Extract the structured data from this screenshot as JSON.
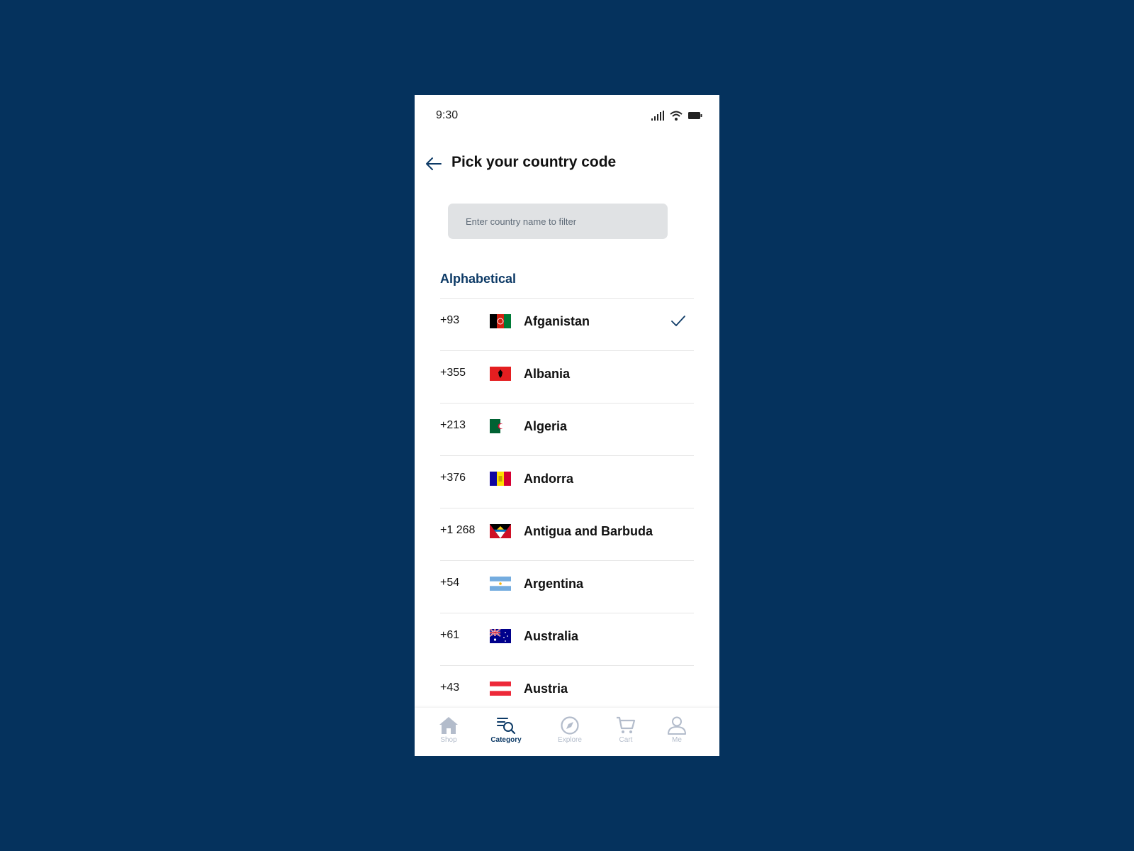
{
  "status_bar": {
    "time": "9:30"
  },
  "header": {
    "title": "Pick your country code"
  },
  "search": {
    "placeholder": "Enter country name to filter",
    "value": ""
  },
  "section": {
    "title": "Alphabetical"
  },
  "countries": [
    {
      "code": "+93",
      "name": "Afganistan",
      "selected": true
    },
    {
      "code": "+355",
      "name": "Albania",
      "selected": false
    },
    {
      "code": "+213",
      "name": "Algeria",
      "selected": false
    },
    {
      "code": "+376",
      "name": "Andorra",
      "selected": false
    },
    {
      "code": "+1 268",
      "name": "Antigua and Barbuda",
      "selected": false
    },
    {
      "code": "+54",
      "name": "Argentina",
      "selected": false
    },
    {
      "code": "+61",
      "name": "Australia",
      "selected": false
    },
    {
      "code": "+43",
      "name": "Austria",
      "selected": false
    }
  ],
  "tabbar": {
    "items": [
      {
        "label": "Shop",
        "icon": "home-icon",
        "active": false
      },
      {
        "label": "Category",
        "icon": "category-search-icon",
        "active": true
      },
      {
        "label": "Explore",
        "icon": "compass-icon",
        "active": false
      },
      {
        "label": "Cart",
        "icon": "cart-icon",
        "active": false
      },
      {
        "label": "Me",
        "icon": "user-icon",
        "active": false
      }
    ]
  },
  "colors": {
    "background": "#05325d",
    "accent": "#0d3a66",
    "search_bg": "#e0e2e4",
    "inactive_tab": "#b3bccb"
  }
}
